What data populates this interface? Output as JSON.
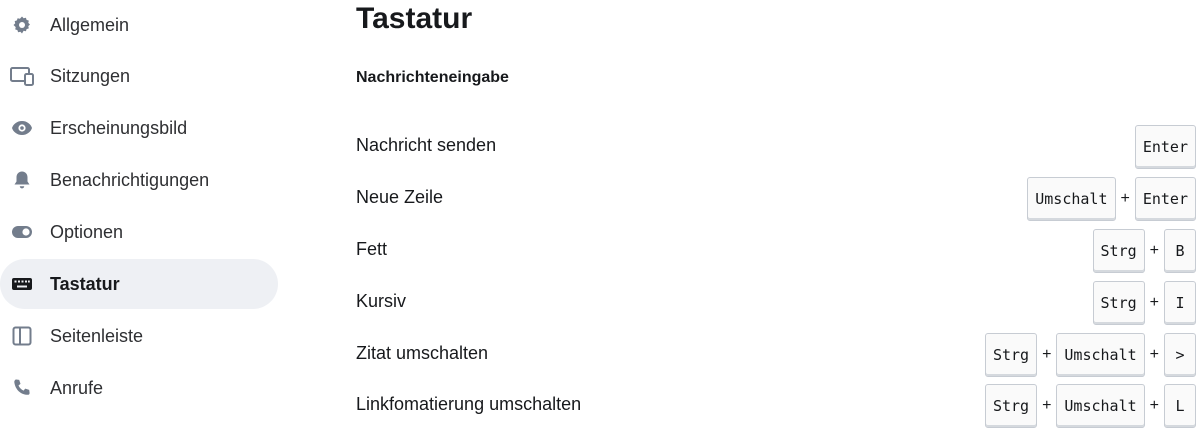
{
  "sidebar": {
    "items": [
      {
        "label": "Allgemein",
        "icon": "gear-icon",
        "active": false
      },
      {
        "label": "Sitzungen",
        "icon": "devices-icon",
        "active": false
      },
      {
        "label": "Erscheinungsbild",
        "icon": "eye-icon",
        "active": false
      },
      {
        "label": "Benachrichtigungen",
        "icon": "bell-icon",
        "active": false
      },
      {
        "label": "Optionen",
        "icon": "toggle-icon",
        "active": false
      },
      {
        "label": "Tastatur",
        "icon": "keyboard-icon",
        "active": true
      },
      {
        "label": "Seitenleiste",
        "icon": "sidebar-icon",
        "active": false
      },
      {
        "label": "Anrufe",
        "icon": "phone-icon",
        "active": false
      }
    ]
  },
  "main": {
    "title": "Tastatur",
    "section_title": "Nachrichteneingabe",
    "shortcuts": [
      {
        "label": "Nachricht senden",
        "keys": [
          "Enter"
        ]
      },
      {
        "label": "Neue Zeile",
        "keys": [
          "Umschalt",
          "Enter"
        ]
      },
      {
        "label": "Fett",
        "keys": [
          "Strg",
          "B"
        ]
      },
      {
        "label": "Kursiv",
        "keys": [
          "Strg",
          "I"
        ]
      },
      {
        "label": "Zitat umschalten",
        "keys": [
          "Strg",
          "Umschalt",
          ">"
        ]
      },
      {
        "label": "Linkfomatierung umschalten",
        "keys": [
          "Strg",
          "Umschalt",
          "L"
        ]
      }
    ],
    "key_separator": "+"
  },
  "colors": {
    "active_item_bg": "#eef0f4",
    "text": "#17191c",
    "icon": "#737d8c"
  }
}
